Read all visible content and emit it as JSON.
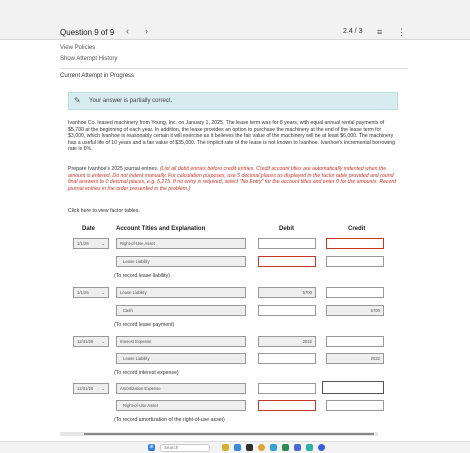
{
  "header": {
    "question_label": "Question 9 of 9",
    "prev_icon": "chevron-left-icon",
    "next_icon": "chevron-right-icon",
    "score": "2.4 / 3",
    "menu_icon": "list-icon",
    "more_icon": "more-vertical-icon"
  },
  "links": {
    "view_policies": "View Policies",
    "show_attempt_history": "Show Attempt History"
  },
  "current_attempt": "Current Attempt in Progress",
  "alert": {
    "icon": "pencil-icon",
    "text": "Your answer is partially correct."
  },
  "problem": {
    "text1": "Ivanhoe Co. leased machinery from Young, Inc. on January 1, 2025. The lease term was for 8 years, with equal annual rental payments of $5,700 at the beginning of each year. In addition, the lease provides an option to purchase the machinery at the end of the lease term for $3,000, which Ivanhoe is reasonably certain it will exercise as it believes the fair value of the machinery will be at least $6,000. The machinery has a useful life of 10 years and a fair value of $35,000. The implicit rate of the lease is not known to Ivanhoe. Ivanhoe's incremental borrowing rate is 6%.",
    "text2_plain": "Prepare Ivanhoe's 2025 journal entries.",
    "text2_italic": " (List all debit entries before credit entries. Credit account titles are automatically indented when the amount is entered. Do not indent manually. For calculation purposes, use 5 decimal places as displayed in the factor table provided and round final answers to 0 decimal places, e.g. 5,275. If no entry is required, select \"No Entry\" for the account titles and enter 0 for the amounts. Record journal entries in the order presented in the problem.)",
    "click_tables": "Click here to view factor tables."
  },
  "table": {
    "headers": {
      "date": "Date",
      "account": "Account Titles and Explanation",
      "debit": "Debit",
      "credit": "Credit"
    },
    "entries": [
      {
        "date": "1/1/25",
        "rows": [
          {
            "account": "Right-of-Use Asset",
            "debit": "",
            "credit": ""
          },
          {
            "account": "Lease Liability",
            "debit": "",
            "credit": ""
          }
        ],
        "caption": "(To record lease liability)"
      },
      {
        "date": "1/1/25",
        "rows": [
          {
            "account": "Lease Liability",
            "debit": "5700",
            "credit": ""
          },
          {
            "account": "Cash",
            "debit": "",
            "credit": "5700"
          }
        ],
        "caption": "(To record lease payment)"
      },
      {
        "date": "12/31/25",
        "rows": [
          {
            "account": "Interest Expense",
            "debit": "2022",
            "credit": ""
          },
          {
            "account": "Lease Liability",
            "debit": "",
            "credit": "2022"
          }
        ],
        "caption": "(To record interest expense)"
      },
      {
        "date": "12/31/25",
        "rows": [
          {
            "account": "Amortization Expense",
            "debit": "",
            "credit": ""
          },
          {
            "account": "Right-of-Use Asset",
            "debit": "",
            "credit": ""
          }
        ],
        "caption": "(To record amortization of the right-of-use asset)"
      }
    ]
  },
  "taskbar": {
    "search_placeholder": "Search"
  },
  "colors": {
    "alert_bg": "#d7ecef",
    "instruction_red": "#c0392b",
    "invalid_border": "#c0392b"
  }
}
